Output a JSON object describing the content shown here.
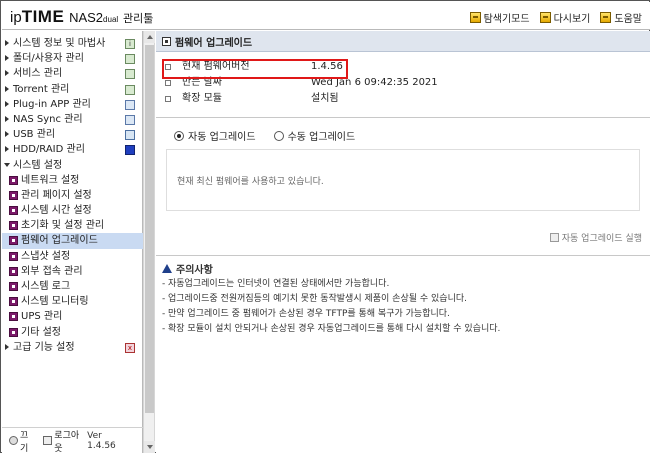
{
  "header": {
    "logo_ip": "ip",
    "logo_time": "TIME",
    "logo_model": "NAS2",
    "logo_model_suffix": "dual",
    "logo_admin": "관리툴",
    "links": [
      {
        "label": "탐색기모드",
        "icon": "explorer-mode-icon"
      },
      {
        "label": "다시보기",
        "icon": "refresh-icon"
      },
      {
        "label": "도움말",
        "icon": "help-icon"
      }
    ]
  },
  "sidebar": {
    "items": [
      {
        "label": "시스템 정보 및 마법사",
        "icon": "info-icon"
      },
      {
        "label": "폴더/사용자 관리",
        "icon": "folder-icon"
      },
      {
        "label": "서비스 관리",
        "icon": "service-icon"
      },
      {
        "label": "Torrent 관리",
        "icon": "torrent-icon"
      },
      {
        "label": "Plug-in APP 관리",
        "icon": "plugin-icon"
      },
      {
        "label": "NAS Sync 관리",
        "icon": "sync-icon"
      },
      {
        "label": "USB 관리",
        "icon": "usb-icon"
      },
      {
        "label": "HDD/RAID 관리",
        "icon": "hdd-icon"
      }
    ],
    "expanded_section": "시스템 설정",
    "sub_items": [
      {
        "label": "네트워크 설정"
      },
      {
        "label": "관리 페이지 설정"
      },
      {
        "label": "시스템 시간 설정"
      },
      {
        "label": "초기화 및 설정 관리"
      },
      {
        "label": "펌웨어 업그레이드",
        "active": true
      },
      {
        "label": "스냅샷 설정"
      },
      {
        "label": "외부 접속 관리"
      },
      {
        "label": "시스템 로그"
      },
      {
        "label": "시스템 모니터링"
      },
      {
        "label": "UPS 관리"
      },
      {
        "label": "기타 설정"
      }
    ],
    "advanced": "고급 기능 설정",
    "footer": {
      "power": "끄기",
      "logout": "로그아웃",
      "version": "Ver 1.4.56"
    }
  },
  "main": {
    "title": "펌웨어 업그레이드",
    "info": [
      {
        "label": "현재 펌웨어버전",
        "value": "1.4.56"
      },
      {
        "label": "만든 날짜",
        "value": "Wed Jan 6 09:42:35 2021"
      },
      {
        "label": "확장 모듈",
        "value": "설치됨"
      }
    ],
    "radio_auto": "자동 업그레이드",
    "radio_manual": "수동 업그레이드",
    "selected": "auto",
    "status_message": "현재 최신 펌웨어를 사용하고 있습니다.",
    "run_auto_button": "자동 업그레이드 실행",
    "notes_title": "주의사항",
    "notes": [
      "자동업그레이드는 인터넷이 연결된 상태에서만 가능합니다.",
      "업그레이드중 전원꺼짐등의 예기치 못한 동작발생시 제품이 손상될 수 있습니다.",
      "만약 업그레이드 중 펌웨어가 손상된 경우 TFTP를 통해 복구가 가능합니다.",
      "확장 모듈이 설치 안되거나 손상된 경우 자동업그레이드를 통해 다시 설치할 수 있습니다."
    ]
  }
}
